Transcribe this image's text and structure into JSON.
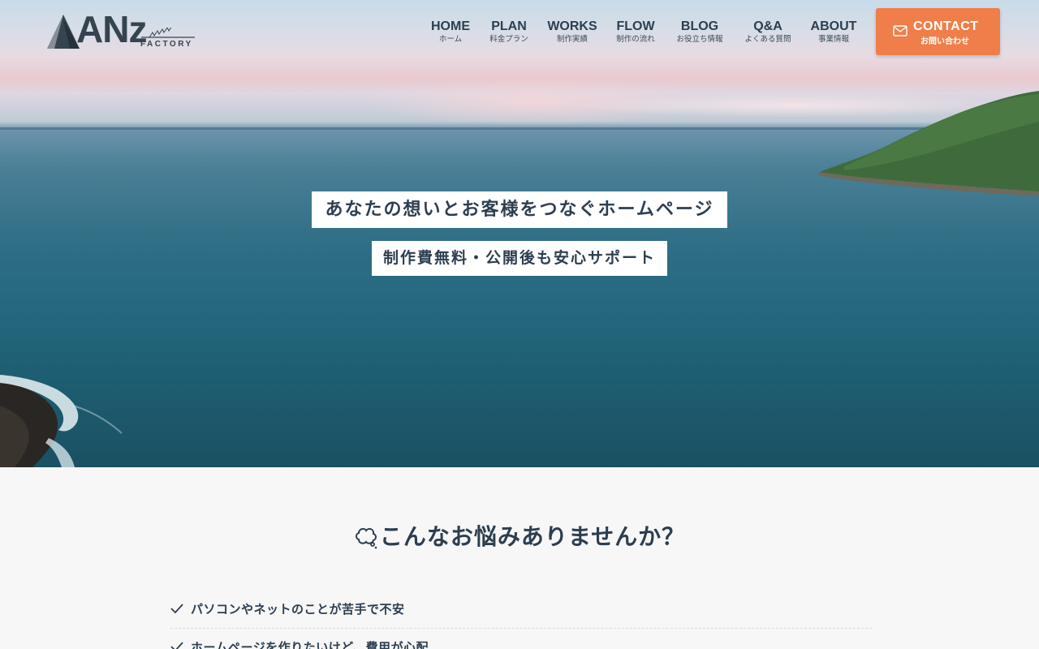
{
  "header": {
    "logo": {
      "text": "ANz",
      "sub": "FACTORY"
    },
    "nav": [
      {
        "en": "HOME",
        "ja": "ホーム"
      },
      {
        "en": "PLAN",
        "ja": "料金プラン"
      },
      {
        "en": "WORKS",
        "ja": "制作実績"
      },
      {
        "en": "FLOW",
        "ja": "制作の流れ"
      },
      {
        "en": "BLOG",
        "ja": "お役立ち情報"
      },
      {
        "en": "Q&A",
        "ja": "よくある質問"
      },
      {
        "en": "ABOUT",
        "ja": "事業情報"
      }
    ],
    "contact": {
      "en": "CONTACT",
      "ja": "お問い合わせ",
      "icon": "mail-icon",
      "color": "#ef7e4a"
    }
  },
  "hero": {
    "title": "あなたの想いとお客様をつなぐホームページ",
    "subtitle": "制作費無料・公開後も安心サポート"
  },
  "concerns": {
    "title": "こんなお悩みありませんか？",
    "icon": "thought-bubble-icon",
    "items": [
      "パソコンやネットのことが苦手で不安",
      "ホームページを作りたいけど、費用が心配"
    ]
  },
  "colors": {
    "text": "#2c3e50",
    "accent": "#ef7e4a",
    "background": "#f7f7f7"
  }
}
